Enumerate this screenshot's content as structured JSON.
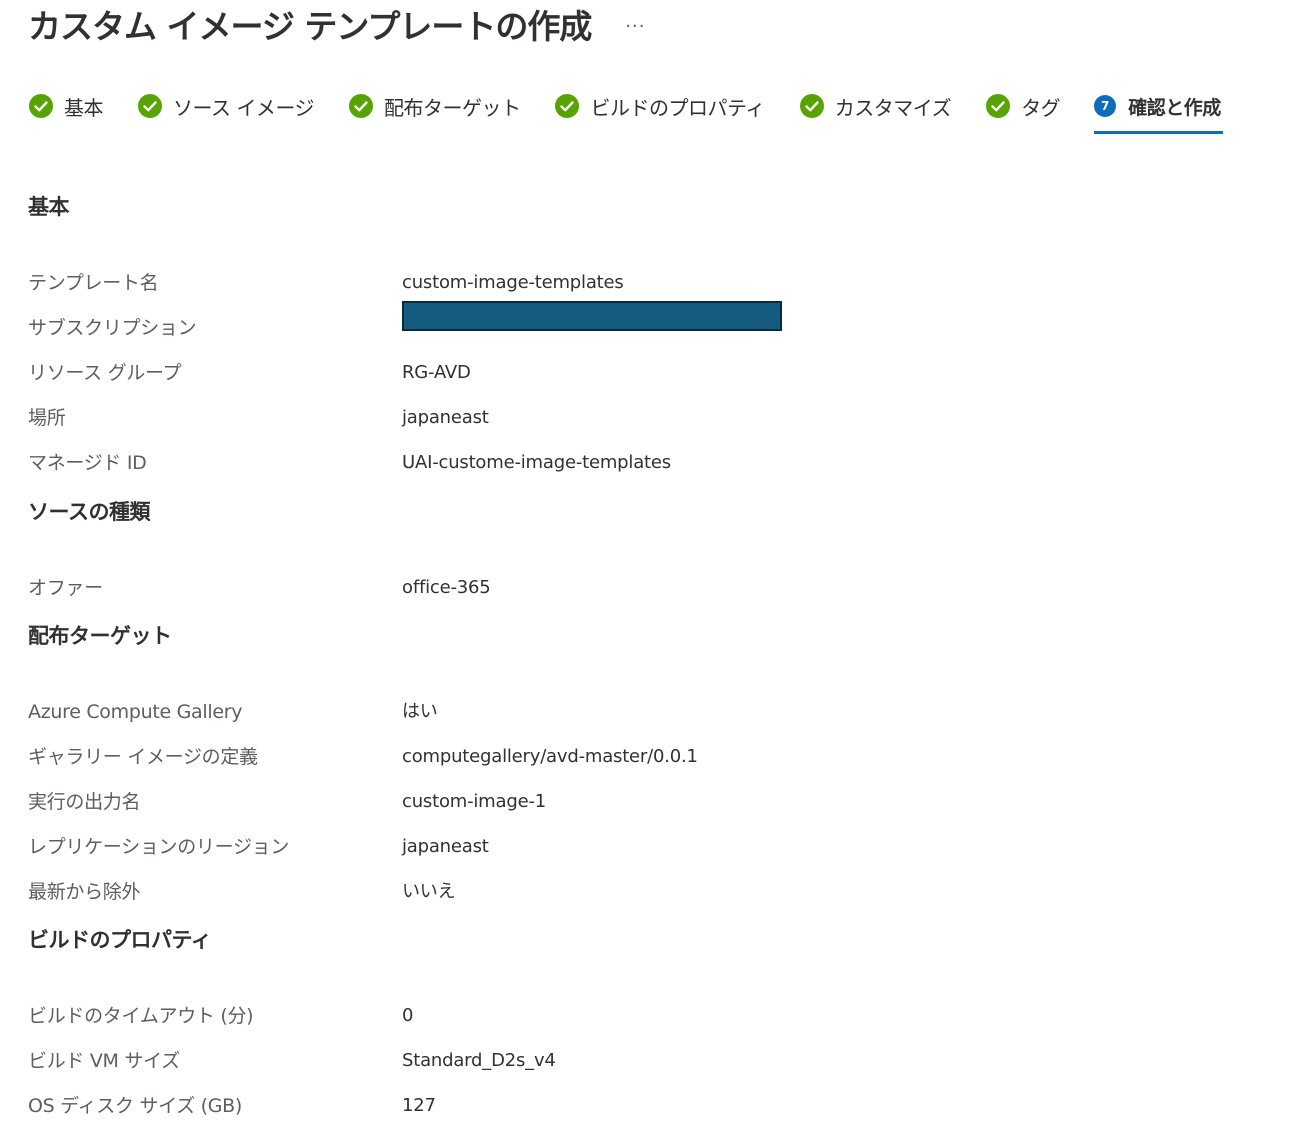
{
  "header": {
    "title": "カスタム イメージ テンプレートの作成",
    "more_label": "···"
  },
  "tabs": [
    {
      "label": "基本",
      "status": "complete"
    },
    {
      "label": "ソース イメージ",
      "status": "complete"
    },
    {
      "label": "配布ターゲット",
      "status": "complete"
    },
    {
      "label": "ビルドのプロパティ",
      "status": "complete"
    },
    {
      "label": "カスタマイズ",
      "status": "complete"
    },
    {
      "label": "タグ",
      "status": "complete"
    },
    {
      "label": "確認と作成",
      "status": "active",
      "step": "7"
    }
  ],
  "colors": {
    "check": "#57a300",
    "accent": "#0f6cbd",
    "redacted": "#145b7f"
  },
  "sections": {
    "basics": {
      "title": "基本",
      "rows": [
        {
          "label": "テンプレート名",
          "value": "custom-image-templates"
        },
        {
          "label": "サブスクリプション",
          "value": ""
        },
        {
          "label": "リソース グループ",
          "value": "RG-AVD"
        },
        {
          "label": "場所",
          "value": "japaneast"
        },
        {
          "label": "マネージド ID",
          "value": "UAI-custome-image-templates"
        }
      ]
    },
    "source": {
      "title": "ソースの種類",
      "rows": [
        {
          "label": "オファー",
          "value": "office-365"
        }
      ]
    },
    "distribution": {
      "title": "配布ターゲット",
      "rows": [
        {
          "label": "Azure Compute Gallery",
          "value": "はい"
        },
        {
          "label": "ギャラリー イメージの定義",
          "value": "computegallery/avd-master/0.0.1"
        },
        {
          "label": "実行の出力名",
          "value": "custom-image-1"
        },
        {
          "label": "レプリケーションのリージョン",
          "value": "japaneast"
        },
        {
          "label": "最新から除外",
          "value": "いいえ"
        }
      ]
    },
    "build": {
      "title": "ビルドのプロパティ",
      "rows": [
        {
          "label": "ビルドのタイムアウト (分)",
          "value": "0"
        },
        {
          "label": "ビルド VM サイズ",
          "value": "Standard_D2s_v4"
        },
        {
          "label": "OS ディスク サイズ (GB)",
          "value": "127"
        }
      ]
    }
  }
}
